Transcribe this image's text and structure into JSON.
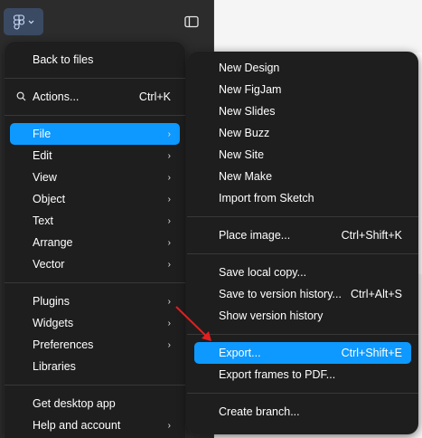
{
  "header": {
    "logo_icon": "figma-logo-icon",
    "logo_caret": "chevron-down-icon",
    "sidebar_toggle_icon": "sidebar-panel-icon"
  },
  "main_menu": {
    "back_to_files": "Back to files",
    "actions": {
      "label": "Actions...",
      "shortcut": "Ctrl+K",
      "icon": "search-icon"
    },
    "group1": [
      {
        "label": "File",
        "active": true
      },
      {
        "label": "Edit"
      },
      {
        "label": "View"
      },
      {
        "label": "Object"
      },
      {
        "label": "Text"
      },
      {
        "label": "Arrange"
      },
      {
        "label": "Vector"
      }
    ],
    "group2": [
      {
        "label": "Plugins",
        "submenu": true
      },
      {
        "label": "Widgets",
        "submenu": true
      },
      {
        "label": "Preferences",
        "submenu": true
      },
      {
        "label": "Libraries",
        "submenu": false
      }
    ],
    "group3": [
      {
        "label": "Get desktop app",
        "submenu": false
      },
      {
        "label": "Help and account",
        "submenu": true
      }
    ],
    "chevron": "›"
  },
  "file_submenu": {
    "new_items": [
      "New Design",
      "New FigJam",
      "New Slides",
      "New Buzz",
      "New Site",
      "New Make",
      "Import from Sketch"
    ],
    "place_image": {
      "label": "Place image...",
      "shortcut": "Ctrl+Shift+K"
    },
    "save_items": [
      {
        "label": "Save local copy...",
        "shortcut": ""
      },
      {
        "label": "Save to version history...",
        "shortcut": "Ctrl+Alt+S"
      },
      {
        "label": "Show version history",
        "shortcut": ""
      }
    ],
    "export": {
      "label": "Export...",
      "shortcut": "Ctrl+Shift+E"
    },
    "export_frames": {
      "label": "Export frames to PDF...",
      "shortcut": ""
    },
    "create_branch": {
      "label": "Create branch...",
      "shortcut": ""
    }
  },
  "colors": {
    "accent": "#0d99ff",
    "menu_bg": "#1e1e1e",
    "annotation_arrow": "#e02020"
  }
}
